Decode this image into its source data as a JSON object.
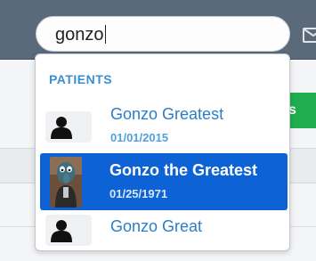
{
  "search": {
    "value": "gonzo"
  },
  "dropdown": {
    "section_label": "PATIENTS",
    "items": [
      {
        "name": "Gonzo Greatest",
        "dob": "01/01/2015",
        "avatar": "person-silhouette-icon",
        "selected": false
      },
      {
        "name": "Gonzo the Greatest",
        "dob": "01/25/1971",
        "avatar": "patient-photo",
        "selected": true
      },
      {
        "name": "Gonzo Great",
        "dob": "",
        "avatar": "person-silhouette-icon",
        "selected": false
      }
    ]
  },
  "background": {
    "green_button_fragment": "s"
  },
  "colors": {
    "topbar": "#5a6a7b",
    "accent": "#2b7ec6",
    "selected_bg": "#0d63d6",
    "green": "#1fae4f"
  }
}
